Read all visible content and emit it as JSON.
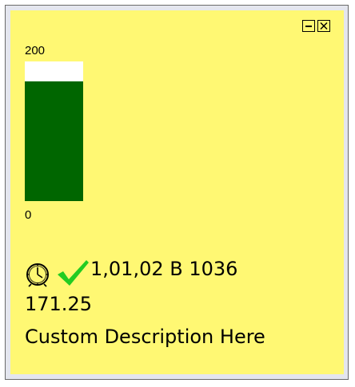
{
  "gauge": {
    "max_label": "200",
    "min_label": "0",
    "max": 200,
    "min": 0,
    "value": 171.25,
    "fill_color": "#006600",
    "empty_color": "#ffffff"
  },
  "status": {
    "time_icon": "clock-icon",
    "ok_icon": "check-icon",
    "ok_color": "#22cc22",
    "text": "1,01,02 B 1036"
  },
  "value_text": "171.25",
  "description": "Custom Description Here",
  "window_controls": {
    "minimize_icon": "minimize-icon",
    "close_icon": "close-icon"
  },
  "colors": {
    "panel_background": "#fff873",
    "frame_background": "#e4e6ee"
  }
}
